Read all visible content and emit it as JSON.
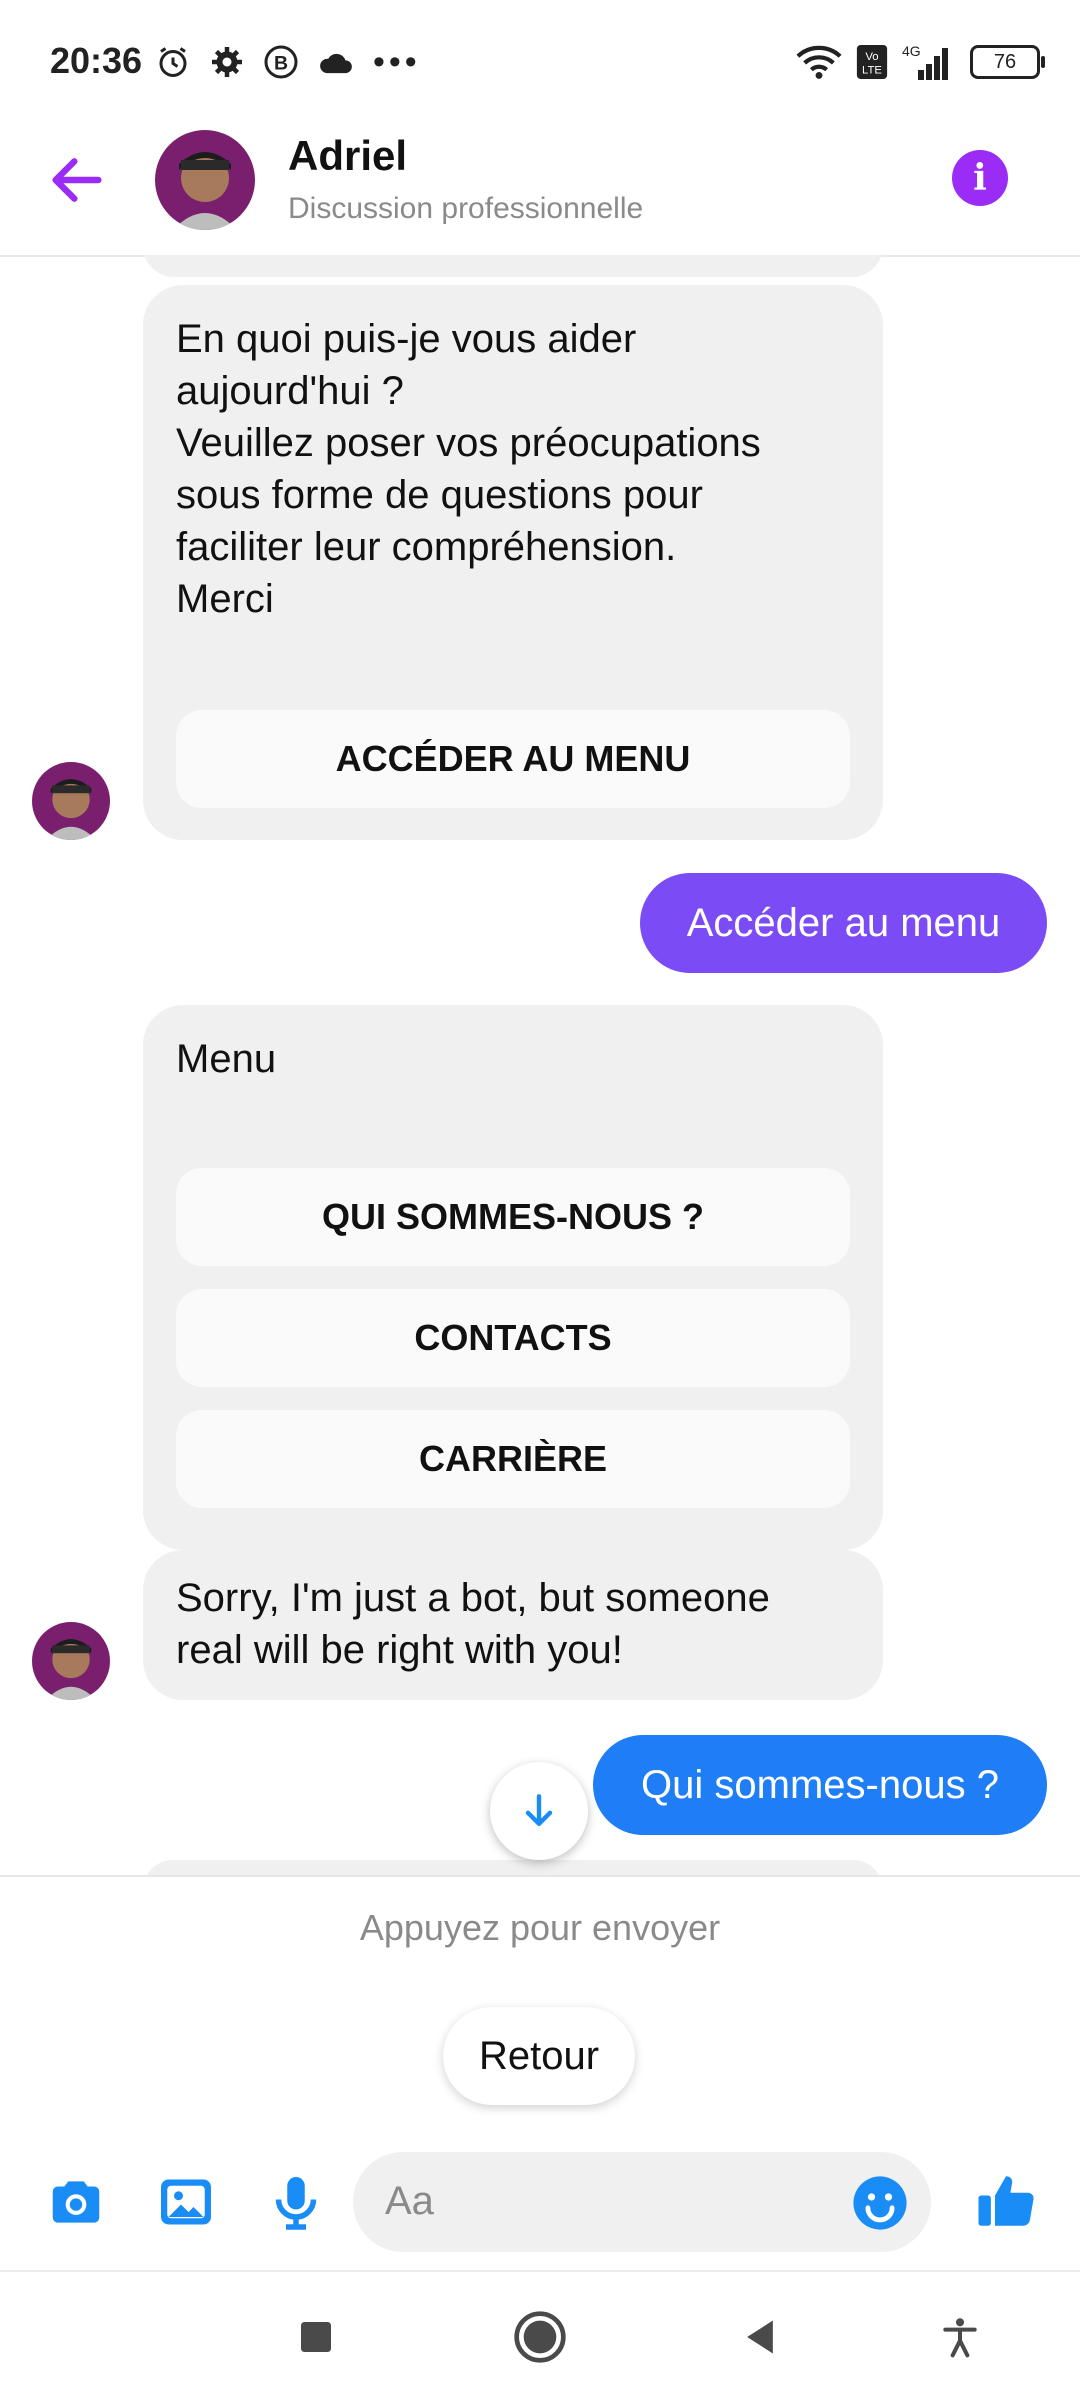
{
  "status_bar": {
    "time": "20:36",
    "battery": "76",
    "network": "4G"
  },
  "header": {
    "name": "Adriel",
    "subtitle": "Discussion professionnelle"
  },
  "messages": {
    "greeting": {
      "lines": [
        "En quoi puis-je vous aider",
        "aujourd'hui ?",
        "Veuillez poser vos préocupations",
        "sous forme de questions pour",
        "faciliter leur compréhension.",
        "Merci"
      ],
      "button": "ACCÉDER AU MENU"
    },
    "sent_1": "Accéder au menu",
    "menu": {
      "title": "Menu",
      "buttons": [
        "QUI SOMMES-NOUS ?",
        "CONTACTS",
        "CARRIÈRE"
      ]
    },
    "bot_reply": {
      "lines": [
        "Sorry, I'm just a bot, but someone",
        "real will be right with you!"
      ]
    },
    "sent_2": "Qui sommes-nous ?"
  },
  "quick_reply": {
    "hint": "Appuyez pour envoyer",
    "retour": "Retour"
  },
  "composer": {
    "placeholder": "Aa"
  },
  "colors": {
    "accent_purple": "#9b2cf5",
    "bubble_purple": "#7b4cf6",
    "bubble_blue": "#1f7ef5",
    "icon_blue": "#1a8cf5"
  }
}
